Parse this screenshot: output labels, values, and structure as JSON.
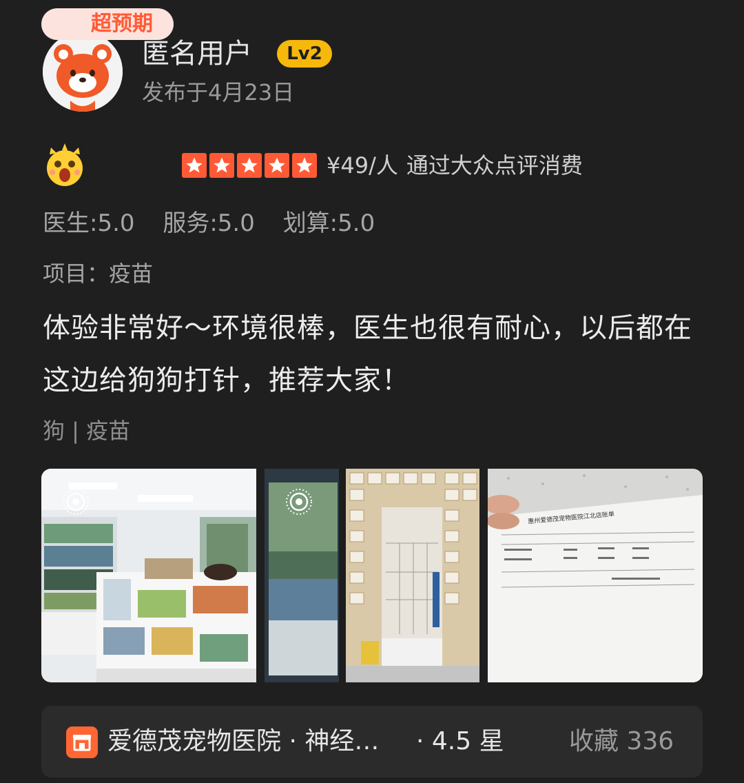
{
  "user": {
    "name": "匿名用户",
    "level": "Lv2",
    "post_date": "发布于4月23日"
  },
  "rating": {
    "badge": "超预期",
    "stars": 5,
    "price": "¥49/人",
    "channel": "通过大众点评消费",
    "sub_scores": [
      "医生:5.0",
      "服务:5.0",
      "划算:5.0"
    ]
  },
  "project": "项目：疫苗",
  "review": "体验非常好～环境很棒，医生也很有耐心，以后都在这边给狗狗打针，推荐大家！",
  "tags": "狗 | 疫苗",
  "photos": [
    {
      "name": "photo-store-shelves",
      "live": true
    },
    {
      "name": "photo-clinic-cages",
      "live": true
    },
    {
      "name": "photo-receipt",
      "live": false
    }
  ],
  "receipt": {
    "title": "惠州爱德茂宠物医院江北店账单"
  },
  "shop": {
    "name": "爱德茂宠物医院 · 神经…",
    "rating": "· 4.5 星",
    "favorites": "收藏 336"
  },
  "colors": {
    "background": "#1f1f1f",
    "accent": "#ff5a35",
    "level_badge": "#f5b80b"
  }
}
